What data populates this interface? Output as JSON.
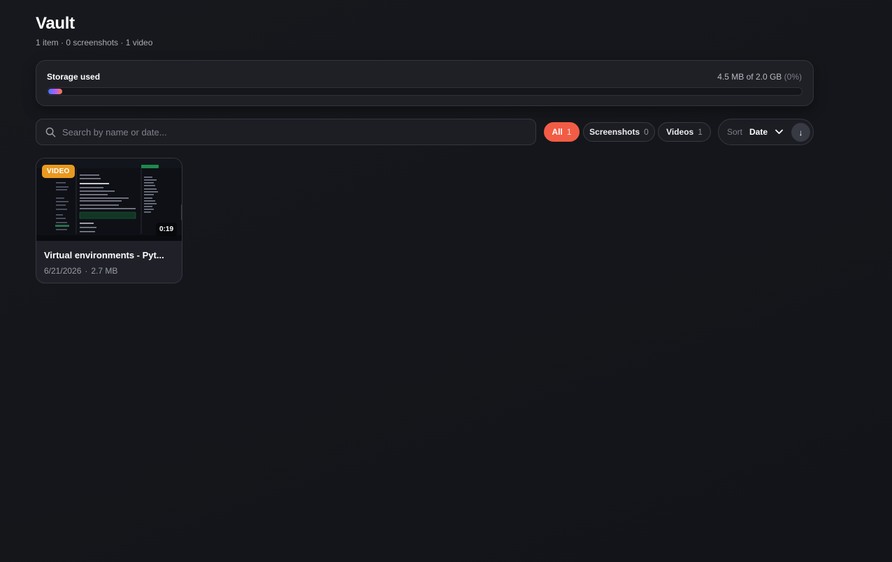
{
  "header": {
    "title": "Vault",
    "summary": "1 item · 0 screenshots · 1 video"
  },
  "storage": {
    "label": "Storage used",
    "amount": "4.5 MB of 2.0 GB",
    "percent_text": "(0%)",
    "fill_fraction": 0.0
  },
  "search": {
    "placeholder": "Search by name or date...",
    "value": "",
    "icon": "search-icon"
  },
  "filters": [
    {
      "label": "All",
      "count": "1",
      "active": true
    },
    {
      "label": "Screenshots",
      "count": "0",
      "active": false
    },
    {
      "label": "Videos",
      "count": "1",
      "active": false
    }
  ],
  "sort": {
    "label": "Sort",
    "value": "Date",
    "direction_glyph": "↓",
    "icon": "chevron-down-icon"
  },
  "items": [
    {
      "type_badge": "VIDEO",
      "duration": "0:19",
      "title": "Virtual environments - Pyt...",
      "date": "6/21/2026",
      "separator": "·",
      "size": "2.7 MB"
    }
  ],
  "colors": {
    "accent": "#f25c45",
    "badge": "#e8991f",
    "background": "#14161b",
    "card": "#202128"
  }
}
